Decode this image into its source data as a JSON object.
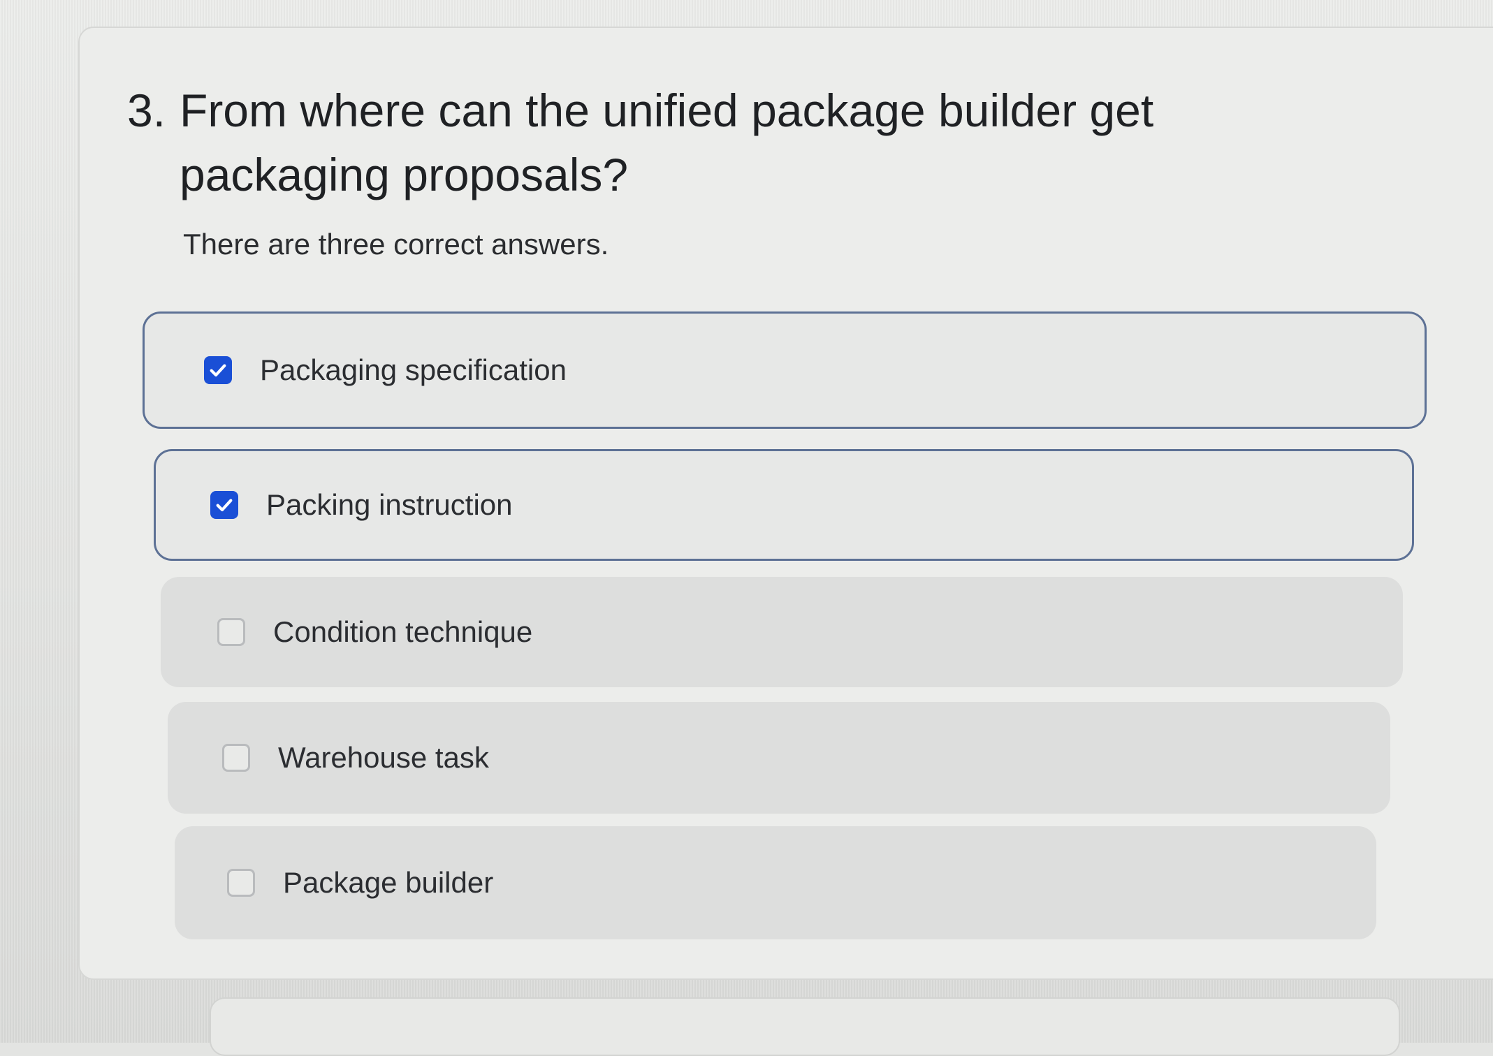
{
  "question": {
    "number": "3.",
    "text": "From where can the unified package builder get packaging proposals?",
    "instruction": "There are three correct answers."
  },
  "options": [
    {
      "label": "Packaging specification",
      "checked": true
    },
    {
      "label": "Packing instruction",
      "checked": true
    },
    {
      "label": "Condition technique",
      "checked": false
    },
    {
      "label": "Warehouse task",
      "checked": false
    },
    {
      "label": "Package builder",
      "checked": false
    }
  ],
  "colors": {
    "checkbox_checked": "#1a4fd6",
    "selected_border": "#5d7195",
    "background": "#e3e4e2"
  },
  "icons": {
    "checked": "checkmark-icon"
  }
}
